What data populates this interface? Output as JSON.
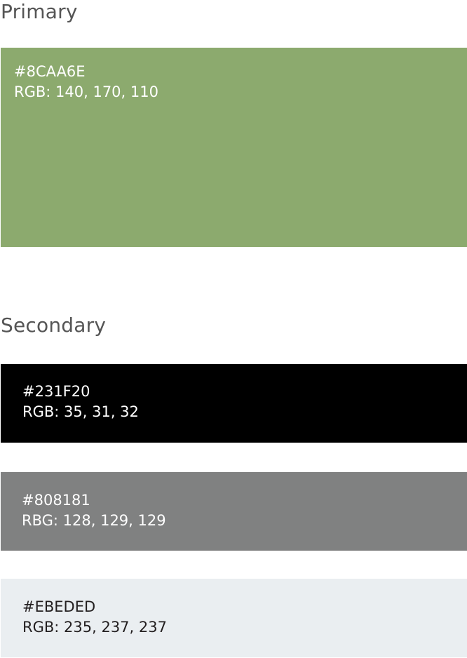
{
  "primary": {
    "title": "Primary",
    "swatches": [
      {
        "hex": "#8CAA6E",
        "rgb": "RGB: 140, 170, 110",
        "color": "#8CAA6E"
      }
    ]
  },
  "secondary": {
    "title": "Secondary",
    "swatches": [
      {
        "hex": "#231F20",
        "rgb": "RGB: 35, 31, 32",
        "color": "#000000"
      },
      {
        "hex": "#808181",
        "rgb": "RBG: 128, 129, 129",
        "color": "#808181"
      },
      {
        "hex": "#EBEDED",
        "rgb": "RGB: 235, 237, 237",
        "color": "#EAEEF1"
      }
    ]
  }
}
